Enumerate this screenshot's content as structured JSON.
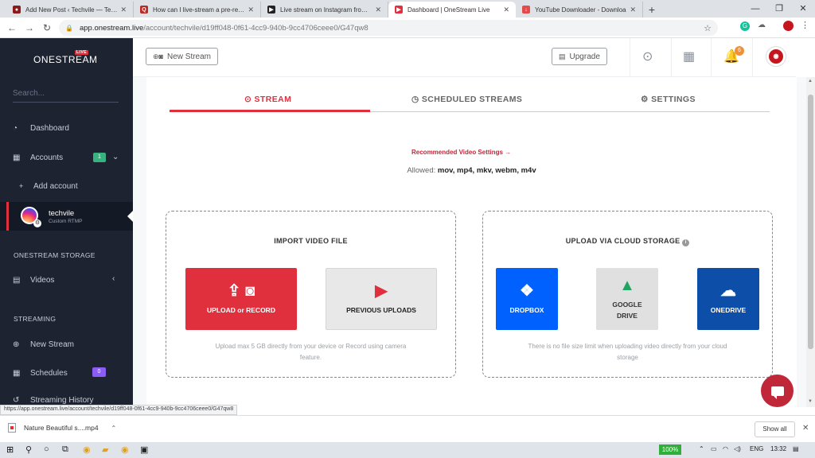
{
  "browser": {
    "tabs": [
      {
        "title": "Add New Post ‹ Techvile — Tech",
        "favicon_color": "#8b1a1a",
        "favicon_glyph": "●"
      },
      {
        "title": "How can I live-stream a pre-recor",
        "favicon_color": "#b92b27",
        "favicon_glyph": "Q"
      },
      {
        "title": "Live stream on Instagram from yo",
        "favicon_color": "#222222",
        "favicon_glyph": "▶"
      },
      {
        "title": "Dashboard | OneStream Live",
        "favicon_color": "#e0303e",
        "favicon_glyph": "▶",
        "active": true
      },
      {
        "title": "YouTube Downloader - Downloa",
        "favicon_color": "#e34a4a",
        "favicon_glyph": "↓"
      }
    ],
    "new_tab": "+",
    "window_controls": [
      "—",
      "❐",
      "✕"
    ],
    "nav": {
      "back": "←",
      "forward": "→",
      "reload": "↻"
    },
    "url_host": "app.onestream.live",
    "url_path": "/account/techvile/d19ff048-0f61-4cc9-940b-9cc4706ceee0/G47qw8",
    "status_url": "https://app.onestream.live/account/techvile/d19ff048-0f61-4cc9-940b-9cc4706ceee0/G47qw8"
  },
  "sidebar": {
    "logo": "ONESTREAM",
    "logo_badge": "LIVE",
    "search_placeholder": "Search...",
    "dashboard": "Dashboard",
    "accounts": "Accounts",
    "accounts_count": "1",
    "add_account": "Add account",
    "account": {
      "name": "techvile",
      "type": "Custom RTMP"
    },
    "storage_heading": "ONESTREAM STORAGE",
    "videos": "Videos",
    "streaming_heading": "STREAMING",
    "new_stream": "New Stream",
    "schedules": "Schedules",
    "schedules_count": "0",
    "streaming_history": "Streaming History"
  },
  "header": {
    "new_stream_button": "New Stream",
    "upgrade_button": "Upgrade",
    "notifications_count": "6"
  },
  "main": {
    "tabs": [
      {
        "label": "STREAM",
        "icon": "play-circle-icon"
      },
      {
        "label": "SCHEDULED STREAMS",
        "icon": "clock-icon"
      },
      {
        "label": "SETTINGS",
        "icon": "gear-icon"
      }
    ],
    "recommended_link": "Recommended Video Settings →",
    "allowed_label": "Allowed:",
    "allowed_formats": "mov, mp4, mkv, webm, m4v",
    "import_panel": {
      "title": "IMPORT VIDEO FILE",
      "upload_button": "UPLOAD or RECORD",
      "previous_button": "PREVIOUS UPLOADS",
      "note": "Upload max 5 GB directly from your device or Record using camera feature."
    },
    "cloud_panel": {
      "title": "UPLOAD VIA CLOUD STORAGE",
      "dropbox": "DROPBOX",
      "google_drive": "GOOGLE DRIVE",
      "onedrive": "ONEDRIVE",
      "note": "There is no file size limit when uploading video directly from your cloud storage"
    }
  },
  "downloads": {
    "file": "Nature Beautiful s....mp4",
    "show_all": "Show all",
    "close": "✕"
  },
  "taskbar": {
    "battery": "100%",
    "language": "ENG",
    "time": "13:32"
  },
  "colors": {
    "accent": "#e0303e",
    "sidebar_bg": "#1e2332",
    "dropbox": "#0061fe",
    "onedrive": "#0c4ea8",
    "google_drive_bg": "#e0e0e0"
  }
}
